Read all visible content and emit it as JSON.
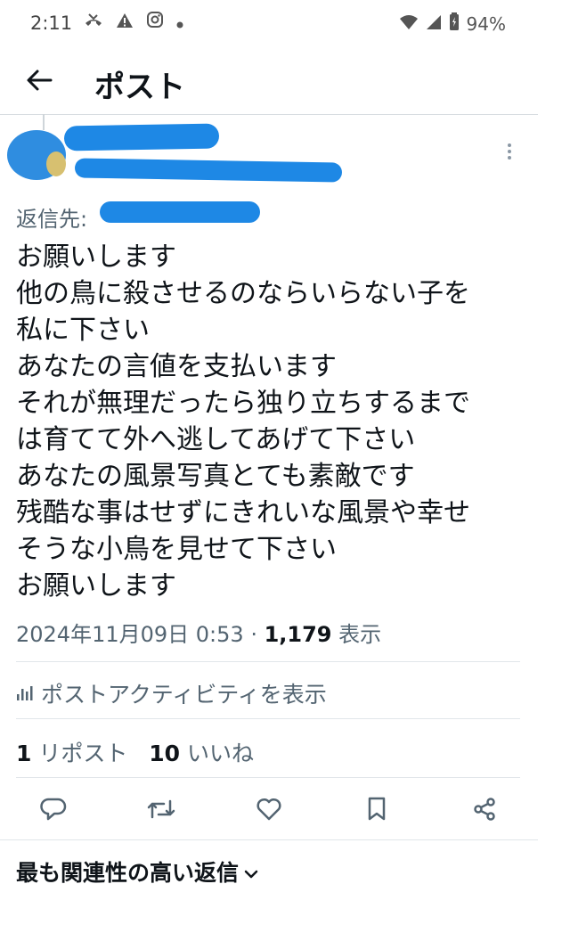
{
  "status_bar": {
    "time": "2:11",
    "battery": "94%"
  },
  "header": {
    "title": "ポスト"
  },
  "post": {
    "reply_to_label": "返信先:",
    "lines": [
      "お願いします",
      "他の鳥に殺させるのならいらない子を",
      "私に下さい",
      "あなたの言値を支払います",
      "それが無理だったら独り立ちするまで",
      "は育てて外へ逃してあげて下さい",
      "あなたの風景写真とても素敵です",
      "残酷な事はせずにきれいな風景や幸せ",
      "そうな小鳥を見せて下さい",
      "お願いします"
    ],
    "timestamp": "2024年11月09日 0:53",
    "separator": " · ",
    "views": "1,179",
    "views_label": " 表示",
    "activity_label": "ポストアクティビティを表示",
    "reposts": "1",
    "reposts_label": " リポスト",
    "likes": "10",
    "likes_label": " いいね"
  },
  "replies_section": {
    "title": "最も関連性の高い返信"
  },
  "colors": {
    "text": "#0f1419",
    "secondary": "#536471",
    "redaction": "#1e88e5"
  }
}
